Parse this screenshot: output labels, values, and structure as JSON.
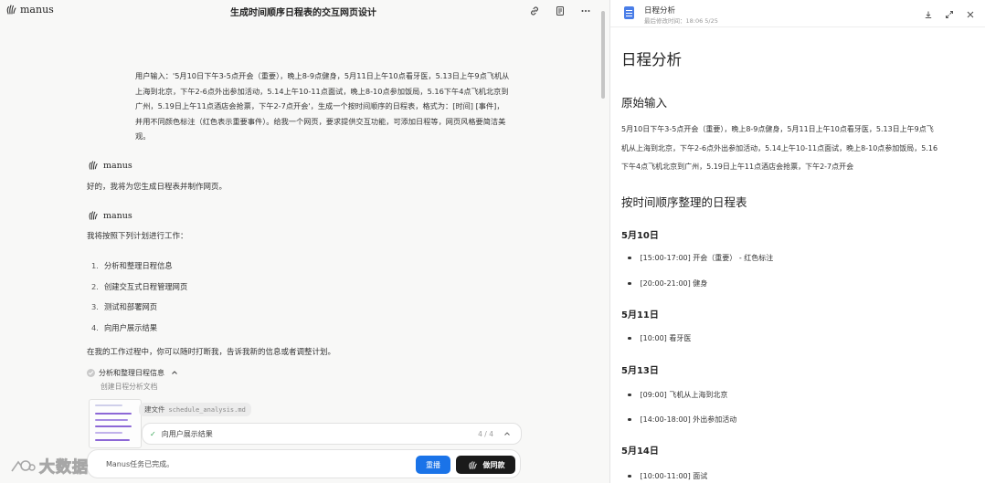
{
  "app": {
    "logo_text": "manus",
    "conversation_title": "生成时间顺序日程表的交互网页设计"
  },
  "conversation": {
    "user_message": "用户输入：'5月10日下午3-5点开会（重要），晚上8-9点健身，5月11日上午10点看牙医，5.13日上午9点飞机从上海到北京，下午2-6点外出参加活动，5.14上午10-11点面试，晚上8-10点参加饭局，5.16下午4点飞机北京到广州，5.19日上午11点酒店会抢票，下午2-7点开会'，生成一个按时间顺序的日程表，格式为：[时间] [事件]，并用不同颜色标注（红色表示重要事件）。给我一个网页，要求提供交互功能，可添加日程等，网页风格要简洁美观。",
    "agent_name": "manus",
    "reply_1": "好的，我将为您生成日程表并制作网页。",
    "reply_2": "我将按照下列计划进行工作：",
    "plan": [
      {
        "num": "1.",
        "text": "分析和整理日程信息"
      },
      {
        "num": "2.",
        "text": "创建交互式日程管理网页"
      },
      {
        "num": "3.",
        "text": "测试和部署网页"
      },
      {
        "num": "4.",
        "text": "向用户展示结果"
      }
    ],
    "note": "在我的工作过程中，你可以随时打断我，告诉我新的信息或者调整计划。",
    "task_title": "分析和整理日程信息",
    "task_subtitle": "创建日程分析文档",
    "file_chip_label": "建文件",
    "file_chip_name": "schedule_analysis.md",
    "progress_label": "向用户展示结果",
    "progress_count": "4 / 4",
    "bottom_status": "Manus任务已完成。",
    "btn_replay": "重播",
    "btn_same": "做同款"
  },
  "watermark": {
    "text": "大数据"
  },
  "document": {
    "title": "日程分析",
    "modified": "最后修改时间：18:06 5/25",
    "heading": "日程分析",
    "section_raw": "原始输入",
    "raw_lines": [
      "5月10日下午3-5点开会（重要），晚上8-9点健身，5月11日上午10点看牙医，5.13日上午9点飞",
      "机从上海到北京，下午2-6点外出参加活动，5.14上午10-11点面试，晚上8-10点参加饭局，5.16",
      "下午4点飞机北京到广州，5.19日上午11点酒店会抢票，下午2-7点开会"
    ],
    "section_sorted": "按时间顺序整理的日程表",
    "days": [
      {
        "date": "5月10日",
        "items": [
          "[15:00-17:00] 开会（重要） - 红色标注",
          "[20:00-21:00] 健身"
        ]
      },
      {
        "date": "5月11日",
        "items": [
          "[10:00] 看牙医"
        ]
      },
      {
        "date": "5月13日",
        "items": [
          "[09:00] 飞机从上海到北京",
          "[14:00-18:00] 外出参加活动"
        ]
      },
      {
        "date": "5月14日",
        "items": [
          "[10:00-11:00] 面试"
        ]
      }
    ]
  }
}
